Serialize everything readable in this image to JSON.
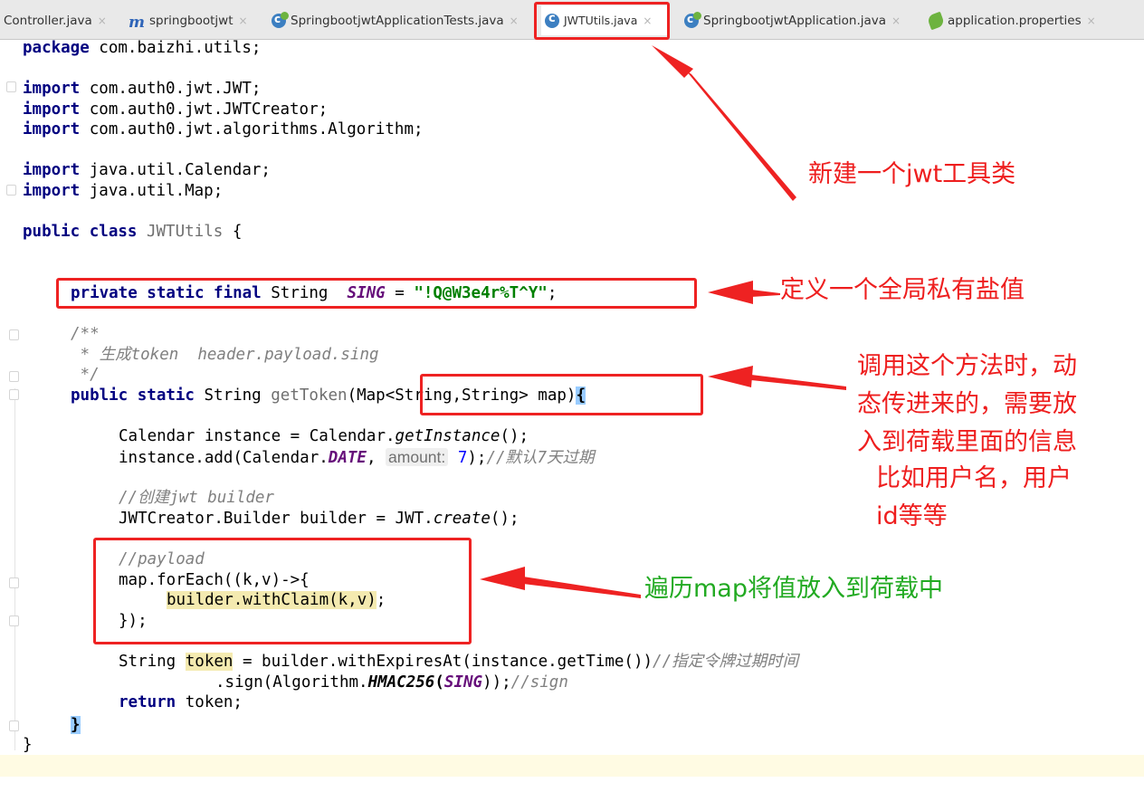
{
  "tabs": [
    {
      "label": "Controller.java",
      "icon": "java-class-icon"
    },
    {
      "label": "springbootjwt",
      "icon": "maven-module-icon"
    },
    {
      "label": "SpringbootjwtApplicationTests.java",
      "icon": "spring-class-icon"
    },
    {
      "label": "JWTUtils.java",
      "icon": "java-class-icon",
      "active": true
    },
    {
      "label": "SpringbootjwtApplication.java",
      "icon": "spring-class-icon"
    },
    {
      "label": "application.properties",
      "icon": "spring-properties-icon"
    }
  ],
  "tab_close_glyph": "×",
  "code": {
    "l01": {
      "k": "package",
      "t": " com.baizhi.utils;"
    },
    "l02": {
      "k": "import",
      "t": " com.auth0.jwt.JWT;"
    },
    "l03": {
      "k": "import",
      "t": " com.auth0.jwt.JWTCreator;"
    },
    "l04": {
      "k": "import",
      "t": " com.auth0.jwt.algorithms.Algorithm;"
    },
    "l05": {
      "k": "import",
      "t": " java.util.Calendar;"
    },
    "l06": {
      "k": "import",
      "t": " java.util.Map;"
    },
    "l07": {
      "k": "public class",
      "name": "JWTUtils",
      "t": " {"
    },
    "l08": {
      "k": "private static final",
      "type": " String  ",
      "const": "SING",
      "eq": " = ",
      "str": "\"!Q@W3e4r%T^Y\"",
      "end": ";"
    },
    "l09": {
      "c": "/**"
    },
    "l10": {
      "c": " * 生成token  header.payload.sing"
    },
    "l11": {
      "c": " */"
    },
    "l12": {
      "k": "public static",
      "type": " String ",
      "name": "getToken",
      "p": "(Map<String,String> map)",
      "b": "{"
    },
    "l13": {
      "a": "Calendar instance = Calendar.",
      "m": "getInstance",
      "e": "();"
    },
    "l14": {
      "a": "instance.add(Calendar.",
      "const": "DATE",
      "s": ", ",
      "hint": "amount:",
      "num": "7",
      "e": ");",
      "c": "//默认7天过期"
    },
    "l15": {
      "c": "//创建jwt builder"
    },
    "l16": {
      "a": "JWTCreator.Builder builder = JWT.",
      "m": "create",
      "e": "();"
    },
    "l17": {
      "c": "//payload"
    },
    "l18": {
      "t": "map.forEach((k,v)->{"
    },
    "l19": {
      "t": "builder.withClaim(k,v)",
      "e": ";"
    },
    "l20": {
      "t": "});"
    },
    "l21": {
      "a": "String ",
      "tok": "token",
      "e": " = builder.withExpiresAt(instance.getTime())",
      "c": "//指定令牌过期时间"
    },
    "l22": {
      "a": ".sign(Algorithm.",
      "m": "HMAC256",
      "p": "(",
      "const": "SING",
      "e": "));",
      "c": "//sign"
    },
    "l23": {
      "k": "return",
      "t": " token;"
    },
    "l24": {
      "b": "}"
    },
    "l25": {
      "t": "}"
    }
  },
  "annotations": {
    "a1": "新建一个jwt工具类",
    "a2": "定义一个全局私有盐值",
    "a3": [
      "调用这个方法时，动",
      "态传进来的，需要放",
      "入到荷载里面的信息",
      "比如用户名，用户",
      "id等等"
    ],
    "a4": "遍历map将值放入到荷载中"
  },
  "colors": {
    "annotation_red": "#ee1e1e",
    "annotation_green": "#22aa22",
    "keyword": "#000080",
    "string": "#008000",
    "constant": "#660e7a",
    "comment": "#808080"
  }
}
